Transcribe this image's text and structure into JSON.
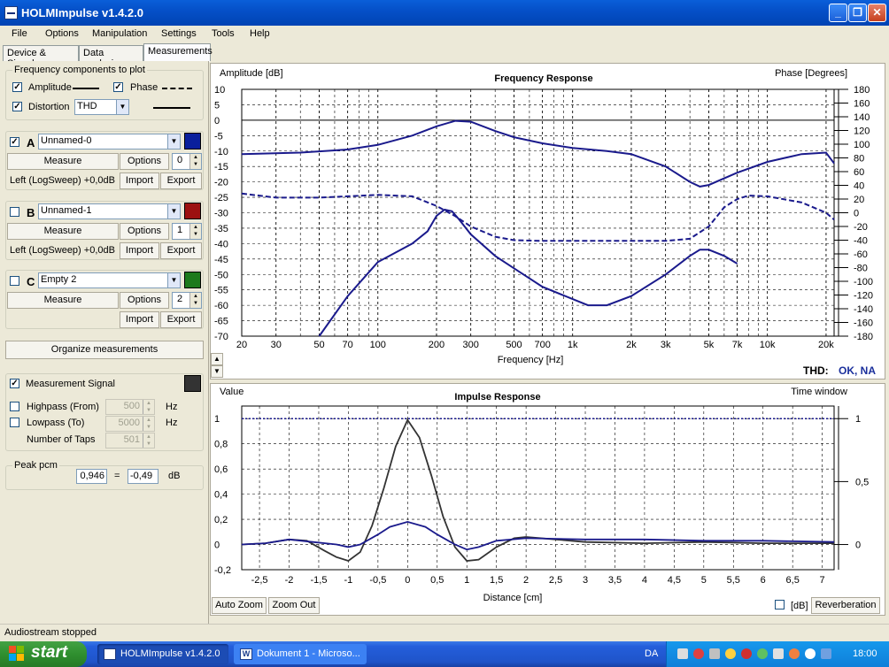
{
  "window": {
    "title": "HOLMImpulse  v1.4.2.0"
  },
  "menu": [
    "File",
    "Options",
    "Manipulation",
    "Settings",
    "Tools",
    "Help"
  ],
  "tabs": [
    "Device & Signal",
    "Data analysis",
    "Measurements"
  ],
  "freq_components": {
    "legend": "Frequency components to plot",
    "amplitude_label": "Amplitude",
    "phase_label": "Phase",
    "distortion_label": "Distortion",
    "distortion_value": "THD"
  },
  "measurements": [
    {
      "letter": "A",
      "checked": true,
      "name": "Unnamed-0",
      "color": "#0a1f9c",
      "index": "0",
      "desc": "Left (LogSweep) +0,0dB"
    },
    {
      "letter": "B",
      "checked": false,
      "name": "Unnamed-1",
      "color": "#9c1010",
      "index": "1",
      "desc": "Left (LogSweep) +0,0dB"
    },
    {
      "letter": "C",
      "checked": false,
      "name": "Empty 2",
      "color": "#1c7a1c",
      "index": "2",
      "desc": ""
    }
  ],
  "buttons": {
    "measure": "Measure",
    "options": "Options",
    "import": "Import",
    "export": "Export",
    "organize": "Organize measurements",
    "auto_zoom": "Auto Zoom",
    "zoom_out": "Zoom Out",
    "reverberation": "Reverberation"
  },
  "signal": {
    "measurement_signal": "Measurement Signal",
    "highpass_label": "Highpass (From)",
    "highpass_value": "500",
    "hz1": "Hz",
    "lowpass_label": "Lowpass (To)",
    "lowpass_value": "5000",
    "hz2": "Hz",
    "taps_label": "Number of Taps",
    "taps_value": "501"
  },
  "peak": {
    "legend": "Peak pcm",
    "value": "0,946",
    "equals": "=",
    "db_value": "-0,49",
    "unit": "dB"
  },
  "status": "Audiostream stopped",
  "taskbar": {
    "start": "start",
    "tasks": [
      "HOLMImpulse  v1.4.2.0",
      "Dokument 1 - Microso..."
    ],
    "lang": "DA",
    "clock": "18:00"
  },
  "thd_label": "THD:",
  "thd_value": "OK, NA",
  "db_checkbox_label": "[dB]",
  "chart_data": [
    {
      "type": "line",
      "title": "Frequency Response",
      "ylabel": "Amplitude [dB]",
      "y2label": "Phase [Degrees]",
      "xlabel": "Frequency [Hz]",
      "xscale": "log",
      "xlim": [
        20,
        22000
      ],
      "ylim": [
        -70,
        10
      ],
      "y2lim": [
        -180,
        180
      ],
      "x_ticks": [
        "20",
        "30",
        "50",
        "70",
        "100",
        "200",
        "300",
        "500",
        "700",
        "1k",
        "2k",
        "3k",
        "5k",
        "7k",
        "10k",
        "20k"
      ],
      "y_ticks": [
        "10",
        "5",
        "0",
        "-5",
        "-10",
        "-15",
        "-20",
        "-25",
        "-30",
        "-35",
        "-40",
        "-45",
        "-50",
        "-55",
        "-60",
        "-65",
        "-70"
      ],
      "y2_ticks": [
        "180",
        "160",
        "140",
        "120",
        "100",
        "80",
        "60",
        "40",
        "20",
        "0",
        "-20",
        "-40",
        "-60",
        "-80",
        "-100",
        "-120",
        "-140",
        "-160",
        "-180"
      ],
      "grid": true,
      "series": [
        {
          "role": "amplitude",
          "color": "#1a1a8c",
          "style": "solid",
          "x": [
            20,
            40,
            70,
            100,
            150,
            200,
            250,
            300,
            400,
            500,
            700,
            1000,
            1500,
            2000,
            3000,
            4000,
            4500,
            5000,
            7000,
            10000,
            15000,
            20000,
            22000
          ],
          "y": [
            -11,
            -10.5,
            -9.5,
            -8,
            -5,
            -2,
            -0.2,
            -0.5,
            -3.5,
            -5.5,
            -7.5,
            -9,
            -10,
            -11,
            -15,
            -20,
            -21.5,
            -21,
            -17,
            -13.5,
            -11,
            -10.5,
            -14
          ]
        },
        {
          "role": "phase",
          "color": "#1a1a8c",
          "style": "dashed",
          "x": [
            20,
            30,
            50,
            100,
            150,
            200,
            250,
            300,
            400,
            500,
            700,
            1000,
            2000,
            3000,
            4000,
            5000,
            6000,
            7000,
            8000,
            10000,
            15000,
            20000,
            22000
          ],
          "y": [
            28,
            22,
            22,
            26,
            24,
            10,
            -5,
            -20,
            -35,
            -40,
            -41,
            -41,
            -41,
            -41,
            -38,
            -20,
            8,
            20,
            25,
            24,
            15,
            0,
            -10
          ]
        },
        {
          "role": "distortion",
          "color": "#1a1a8c",
          "style": "solid",
          "x": [
            50,
            70,
            100,
            150,
            180,
            200,
            220,
            240,
            260,
            300,
            400,
            500,
            700,
            1000,
            1200,
            1500,
            2000,
            3000,
            4000,
            4500,
            5000,
            6000,
            7000
          ],
          "y": [
            -70,
            -57,
            -46,
            -40,
            -36,
            -31,
            -29,
            -29.5,
            -32,
            -37,
            -44,
            -48,
            -54,
            -58,
            -60,
            -60,
            -57,
            -50,
            -44,
            -42,
            -42,
            -44,
            -46.5
          ]
        }
      ]
    },
    {
      "type": "line",
      "title": "Impulse Response",
      "ylabel": "Value",
      "y2label": "Time window",
      "xlabel": "Distance [cm]",
      "xlim": [
        -2.8,
        7.2
      ],
      "ylim": [
        -0.2,
        1.1
      ],
      "y2lim": [
        0,
        1
      ],
      "x_ticks": [
        "-2,5",
        "-2",
        "-1,5",
        "-1",
        "-0,5",
        "0",
        "0,5",
        "1",
        "1,5",
        "2",
        "2,5",
        "3",
        "3,5",
        "4",
        "4,5",
        "5",
        "5,5",
        "6",
        "6,5",
        "7"
      ],
      "y_ticks": [
        "1",
        "0,8",
        "0,6",
        "0,4",
        "0,2",
        "0",
        "-0,2"
      ],
      "y2_ticks": [
        "1",
        "0,5",
        "0"
      ],
      "grid": true,
      "series": [
        {
          "role": "impulse_raw",
          "color": "#333333",
          "style": "solid",
          "x": [
            -2.8,
            -2.4,
            -2,
            -1.7,
            -1.4,
            -1.2,
            -1,
            -0.8,
            -0.6,
            -0.4,
            -0.2,
            0,
            0.2,
            0.4,
            0.6,
            0.8,
            1,
            1.2,
            1.5,
            1.8,
            2,
            2.5,
            3,
            4,
            5,
            6,
            7.2
          ],
          "y": [
            0,
            0.01,
            0.04,
            0.03,
            -0.05,
            -0.1,
            -0.13,
            -0.06,
            0.15,
            0.45,
            0.78,
            0.99,
            0.85,
            0.55,
            0.22,
            -0.02,
            -0.13,
            -0.12,
            -0.02,
            0.05,
            0.06,
            0.04,
            0.02,
            0.01,
            0.02,
            0.01,
            0.01
          ]
        },
        {
          "role": "impulse_windowed",
          "color": "#1a1a8c",
          "style": "solid",
          "x": [
            -2.8,
            -2.4,
            -2,
            -1.6,
            -1.2,
            -1,
            -0.8,
            -0.5,
            -0.3,
            0,
            0.3,
            0.5,
            0.8,
            1,
            1.2,
            1.5,
            2,
            3,
            4,
            5,
            6,
            7.2
          ],
          "y": [
            0,
            0.01,
            0.04,
            0.02,
            0,
            -0.02,
            0,
            0.08,
            0.14,
            0.18,
            0.14,
            0.08,
            0,
            -0.04,
            -0.02,
            0.03,
            0.05,
            0.04,
            0.04,
            0.03,
            0.03,
            0.02
          ]
        },
        {
          "role": "time_window",
          "color": "#1a1a8c",
          "style": "dotted",
          "x": [
            -2.8,
            7.2
          ],
          "y": [
            1,
            1
          ]
        }
      ]
    }
  ]
}
